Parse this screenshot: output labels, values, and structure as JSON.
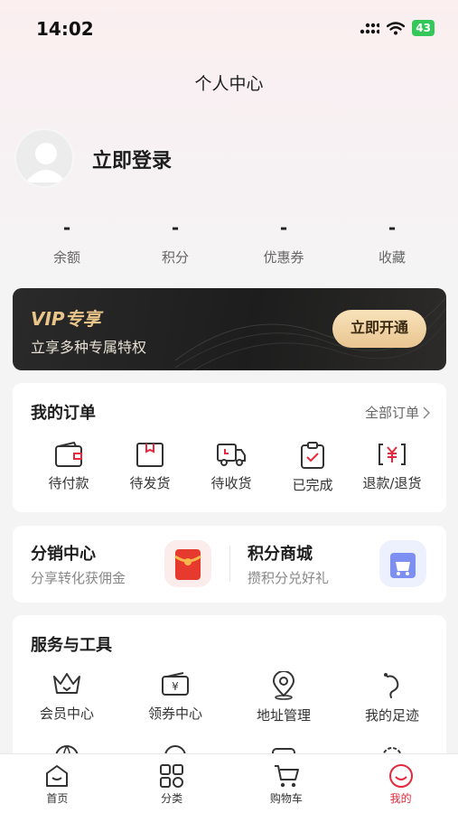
{
  "status_bar": {
    "time": "14:02",
    "battery": "43"
  },
  "header": {
    "title": "个人中心"
  },
  "profile": {
    "login_label": "立即登录"
  },
  "stats": [
    {
      "value": "-",
      "label": "余额"
    },
    {
      "value": "-",
      "label": "积分"
    },
    {
      "value": "-",
      "label": "优惠券"
    },
    {
      "value": "-",
      "label": "收藏"
    }
  ],
  "vip": {
    "badge": "VIP专享",
    "subtitle": "立享多种专属特权",
    "button": "立即开通"
  },
  "orders": {
    "title": "我的订单",
    "all_label": "全部订单",
    "items": [
      {
        "label": "待付款",
        "icon": "wallet-icon"
      },
      {
        "label": "待发货",
        "icon": "package-icon"
      },
      {
        "label": "待收货",
        "icon": "truck-icon"
      },
      {
        "label": "已完成",
        "icon": "clipboard-check-icon"
      },
      {
        "label": "退款/退货",
        "icon": "refund-icon"
      }
    ]
  },
  "promo": {
    "distribution": {
      "title": "分销中心",
      "subtitle": "分享转化获佣金"
    },
    "points_mall": {
      "title": "积分商城",
      "subtitle": "攒积分兑好礼"
    }
  },
  "services": {
    "title": "服务与工具",
    "items": [
      {
        "label": "会员中心",
        "icon": "crown-icon"
      },
      {
        "label": "领券中心",
        "icon": "coupon-icon"
      },
      {
        "label": "地址管理",
        "icon": "location-icon"
      },
      {
        "label": "我的足迹",
        "icon": "footprint-icon"
      }
    ]
  },
  "tabbar": {
    "items": [
      {
        "label": "首页",
        "icon": "home-icon"
      },
      {
        "label": "分类",
        "icon": "category-icon"
      },
      {
        "label": "购物车",
        "icon": "cart-icon"
      },
      {
        "label": "我的",
        "icon": "profile-icon"
      }
    ],
    "active_index": 3
  },
  "colors": {
    "accent": "#e6283c",
    "vip_gold": "#e9c58a"
  }
}
